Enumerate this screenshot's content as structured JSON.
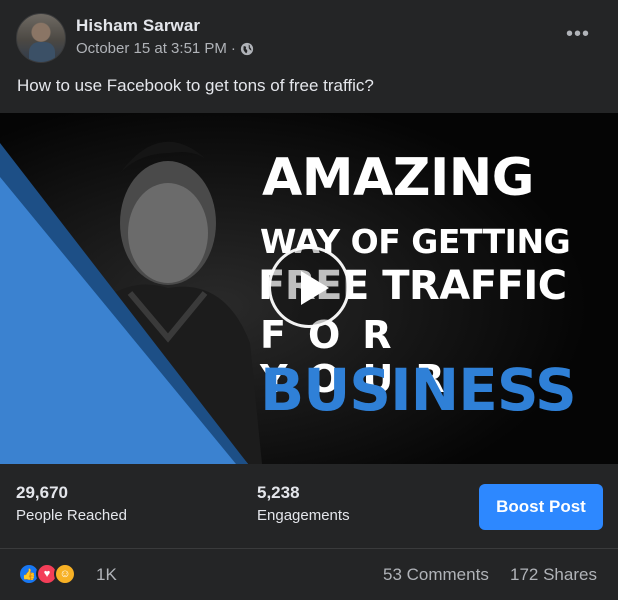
{
  "post": {
    "author": "Hisham Sarwar",
    "timestamp": "October 15 at 3:51 PM",
    "separator": "·",
    "privacy_icon": "globe-icon",
    "more_label": "•••",
    "text": "How to use Facebook to get tons of free traffic?"
  },
  "video": {
    "line1": "AMAZING",
    "line2": "WAY OF GETTING",
    "line3": "FREE TRAFFIC",
    "line4": "FOR YOUR",
    "line5": "BUSINESS",
    "accent_color": "#2f80d7",
    "play_icon": "play-icon"
  },
  "insights": {
    "reached_value": "29,670",
    "reached_label": "People Reached",
    "engagements_value": "5,238",
    "engagements_label": "Engagements",
    "boost_label": "Boost Post"
  },
  "reactions": {
    "icons": [
      "like-icon",
      "love-icon",
      "care-icon"
    ],
    "count": "1K",
    "comments": "53 Comments",
    "shares": "172 Shares"
  },
  "colors": {
    "background": "#242526",
    "primary_button": "#2d88ff",
    "text_secondary": "#b0b3b8"
  }
}
